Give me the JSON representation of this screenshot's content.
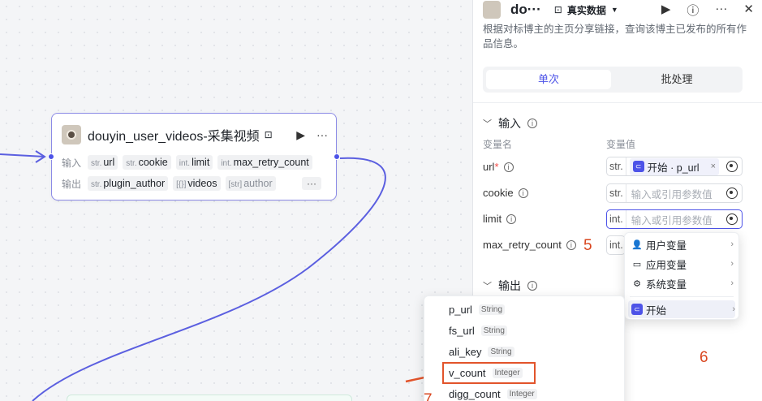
{
  "node": {
    "title": "douyin_user_videos-采集视频",
    "input_label": "输入",
    "output_label": "输出",
    "inputs": [
      {
        "type": "str.",
        "name": "url"
      },
      {
        "type": "str.",
        "name": "cookie"
      },
      {
        "type": "int.",
        "name": "limit"
      },
      {
        "type": "int.",
        "name": "max_retry_count"
      }
    ],
    "outputs": [
      {
        "type": "str.",
        "name": "plugin_author"
      },
      {
        "type": "[{}]",
        "name": "videos"
      },
      {
        "type": "[str]",
        "name": "author"
      }
    ],
    "more": "···"
  },
  "panel": {
    "name": "do···",
    "mode": "真实数据",
    "description": "根据对标博主的主页分享链接，查询该博主已发布的所有作品信息。",
    "tabs": [
      "单次",
      "批处理"
    ],
    "input_section": "输入",
    "output_section": "输出",
    "col_name": "变量名",
    "col_value": "变量值",
    "rows": [
      {
        "name": "url",
        "required": true,
        "type": "str.",
        "chip": "开始 · p_url",
        "placeholder": ""
      },
      {
        "name": "cookie",
        "required": false,
        "type": "str.",
        "chip": "",
        "placeholder": "输入或引用参数值"
      },
      {
        "name": "limit",
        "required": false,
        "type": "int.",
        "chip": "",
        "placeholder": "输入或引用参数值"
      },
      {
        "name": "max_retry_count",
        "required": false,
        "type": "int.",
        "chip": "",
        "placeholder": ""
      }
    ]
  },
  "menu": {
    "items": [
      {
        "icon": "person-icon",
        "label": "用户变量"
      },
      {
        "icon": "folder-icon",
        "label": "应用变量"
      },
      {
        "icon": "gear-icon",
        "label": "系统变量"
      },
      {
        "icon": "start-icon",
        "label": "开始"
      }
    ]
  },
  "vars": [
    {
      "name": "p_url",
      "type": "String"
    },
    {
      "name": "fs_url",
      "type": "String"
    },
    {
      "name": "ali_key",
      "type": "String"
    },
    {
      "name": "v_count",
      "type": "Integer"
    },
    {
      "name": "digg_count",
      "type": "Integer"
    }
  ],
  "annotations": {
    "five": "5",
    "six": "6",
    "seven": "7"
  },
  "colors": {
    "accent": "#4d53e8",
    "annotation": "#e2542b"
  }
}
